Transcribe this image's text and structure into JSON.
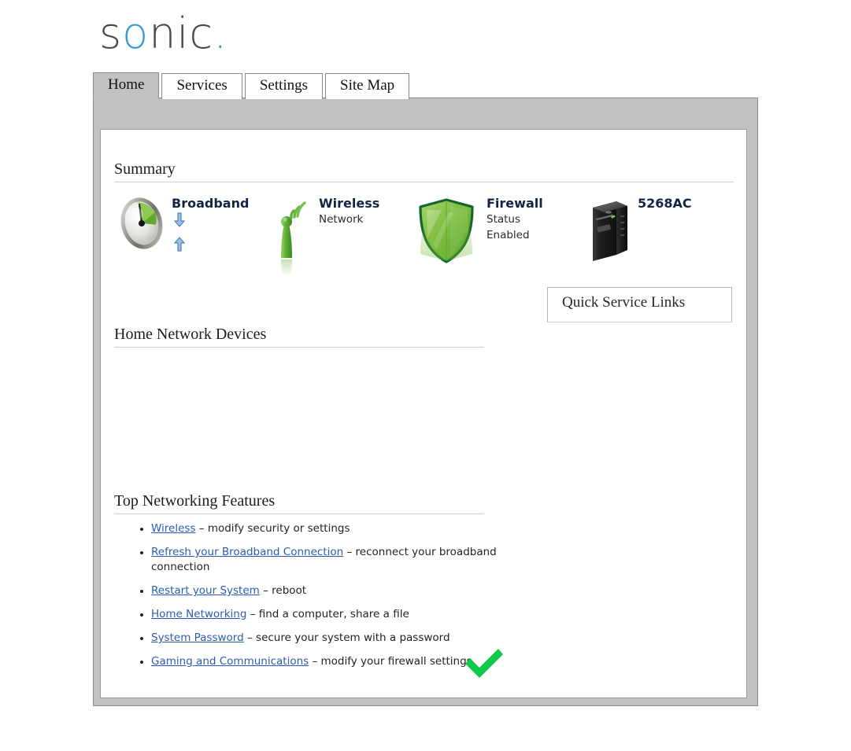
{
  "brand": {
    "logo_part1": "s",
    "logo_part2": "o",
    "logo_part3": "nic",
    "logo_dot": ".",
    "accent_color": "#3d9bd4",
    "text_color": "#4b4a46"
  },
  "tabs": [
    {
      "label": "Home",
      "active": true
    },
    {
      "label": "Services",
      "active": false
    },
    {
      "label": "Settings",
      "active": false
    },
    {
      "label": "Site Map",
      "active": false
    }
  ],
  "sections": {
    "summary": {
      "heading": "Summary"
    },
    "home_network_devices": {
      "heading": "Home Network Devices",
      "items": []
    },
    "top_networking_features": {
      "heading": "Top Networking Features"
    }
  },
  "summary_tiles": {
    "broadband": {
      "title": "Broadband",
      "icon": "speedometer-gauge-icon",
      "downstream_icon": "arrow-down-icon",
      "upstream_icon": "arrow-up-icon",
      "arrow_color": "#6d9ed6"
    },
    "wireless": {
      "title": "Wireless",
      "subtitle": "Network",
      "icon": "wireless-antenna-icon",
      "color": "#57a937"
    },
    "firewall": {
      "title": "Firewall",
      "status_label": "Status",
      "status_value": "Enabled",
      "icon": "shield-icon",
      "color": "#7cc142"
    },
    "router": {
      "title": "5268AC",
      "icon": "router-device-icon"
    }
  },
  "quick_service_links": {
    "title": "Quick Service Links",
    "links": []
  },
  "features": [
    {
      "link": "Wireless",
      "description": " – modify security or settings"
    },
    {
      "link": "Refresh your Broadband Connection",
      "description": " – reconnect your broadband connection"
    },
    {
      "link": "Restart your System",
      "description": " – reboot"
    },
    {
      "link": "Home Networking",
      "description": " – find a computer, share a file"
    },
    {
      "link": "System Password",
      "description": " – secure your system with a password"
    },
    {
      "link": "Gaming and Communications",
      "description": " – modify your firewall settings"
    }
  ],
  "cursor": {
    "icon": "green-checkmark-icon",
    "color": "#0ec94a"
  }
}
